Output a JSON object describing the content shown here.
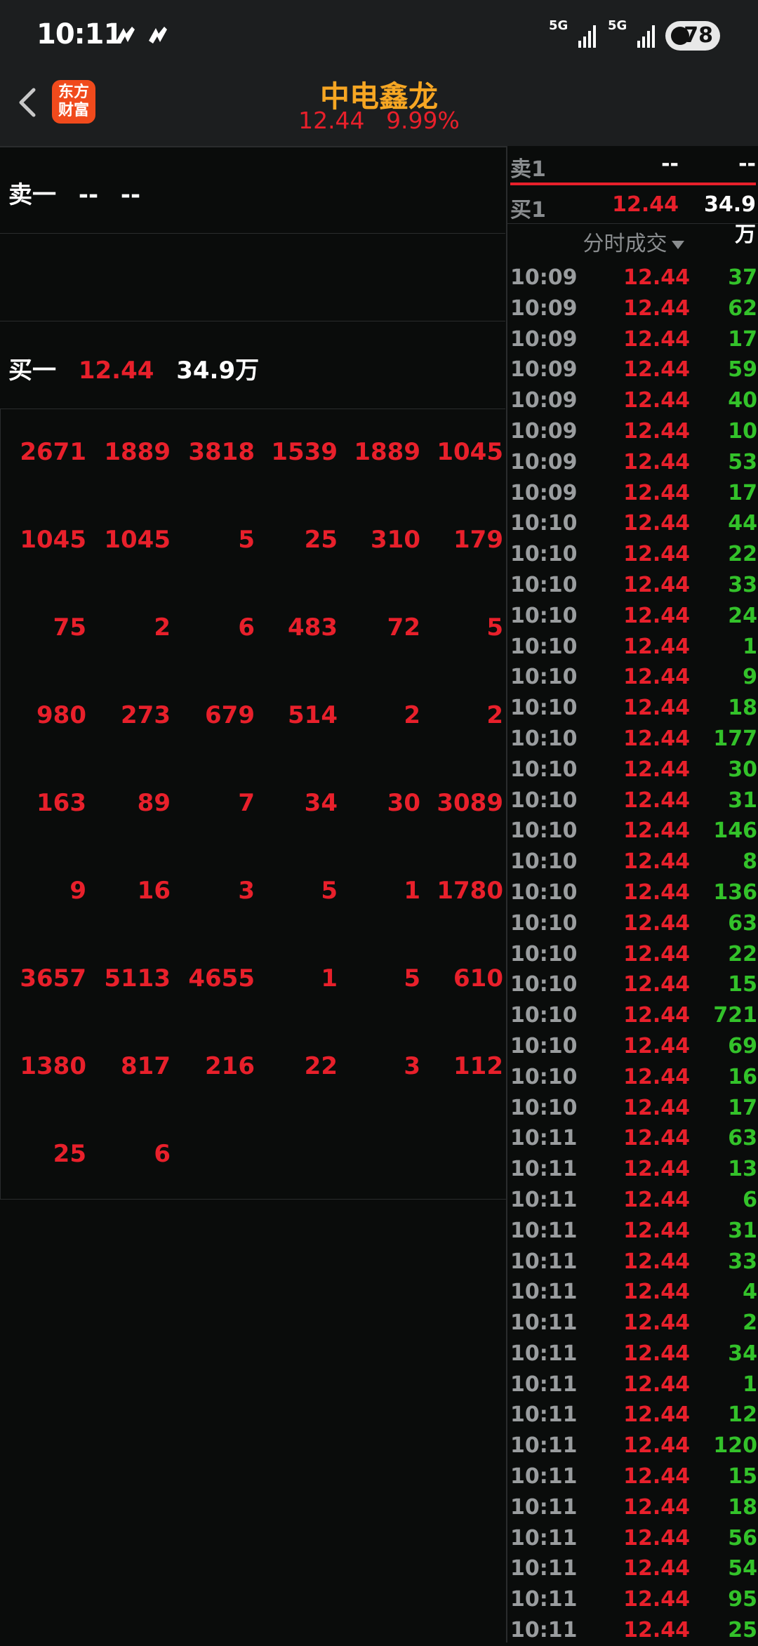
{
  "status_bar": {
    "time": "10:11",
    "network_1": "5G",
    "network_2": "5G",
    "battery": "78"
  },
  "header": {
    "logo_line1": "东方",
    "logo_line2": "财富",
    "stock_name": "中电鑫龙",
    "price": "12.44",
    "change_pct": "9.99%"
  },
  "order_book": {
    "sell1": {
      "label": "卖一",
      "price": "--",
      "volume": "--"
    },
    "buy1": {
      "label": "买一",
      "price": "12.44",
      "volume": "34.9万"
    }
  },
  "queue_rows": [
    [
      "2671",
      "1889",
      "3818",
      "1539",
      "1889",
      "1045"
    ],
    [
      "1045",
      "1045",
      "5",
      "25",
      "310",
      "179"
    ],
    [
      "75",
      "2",
      "6",
      "483",
      "72",
      "5"
    ],
    [
      "980",
      "273",
      "679",
      "514",
      "2",
      "2"
    ],
    [
      "163",
      "89",
      "7",
      "34",
      "30",
      "3089"
    ],
    [
      "9",
      "16",
      "3",
      "5",
      "1",
      "1780"
    ],
    [
      "3657",
      "5113",
      "4655",
      "1",
      "5",
      "610"
    ],
    [
      "1380",
      "817",
      "216",
      "22",
      "3",
      "112"
    ],
    [
      "25",
      "6"
    ]
  ],
  "quote": {
    "sell1": {
      "label": "卖1",
      "price": "--",
      "volume": "--"
    },
    "buy1": {
      "label": "买1",
      "price": "12.44",
      "volume": "34.9万"
    }
  },
  "ticks_header": "分时成交",
  "ticks": [
    {
      "time": "10:09",
      "price": "12.44",
      "vol": "37"
    },
    {
      "time": "10:09",
      "price": "12.44",
      "vol": "62"
    },
    {
      "time": "10:09",
      "price": "12.44",
      "vol": "17"
    },
    {
      "time": "10:09",
      "price": "12.44",
      "vol": "59"
    },
    {
      "time": "10:09",
      "price": "12.44",
      "vol": "40"
    },
    {
      "time": "10:09",
      "price": "12.44",
      "vol": "10"
    },
    {
      "time": "10:09",
      "price": "12.44",
      "vol": "53"
    },
    {
      "time": "10:09",
      "price": "12.44",
      "vol": "17"
    },
    {
      "time": "10:10",
      "price": "12.44",
      "vol": "44"
    },
    {
      "time": "10:10",
      "price": "12.44",
      "vol": "22"
    },
    {
      "time": "10:10",
      "price": "12.44",
      "vol": "33"
    },
    {
      "time": "10:10",
      "price": "12.44",
      "vol": "24"
    },
    {
      "time": "10:10",
      "price": "12.44",
      "vol": "1"
    },
    {
      "time": "10:10",
      "price": "12.44",
      "vol": "9"
    },
    {
      "time": "10:10",
      "price": "12.44",
      "vol": "18"
    },
    {
      "time": "10:10",
      "price": "12.44",
      "vol": "177"
    },
    {
      "time": "10:10",
      "price": "12.44",
      "vol": "30"
    },
    {
      "time": "10:10",
      "price": "12.44",
      "vol": "31"
    },
    {
      "time": "10:10",
      "price": "12.44",
      "vol": "146"
    },
    {
      "time": "10:10",
      "price": "12.44",
      "vol": "8"
    },
    {
      "time": "10:10",
      "price": "12.44",
      "vol": "136"
    },
    {
      "time": "10:10",
      "price": "12.44",
      "vol": "63"
    },
    {
      "time": "10:10",
      "price": "12.44",
      "vol": "22"
    },
    {
      "time": "10:10",
      "price": "12.44",
      "vol": "15"
    },
    {
      "time": "10:10",
      "price": "12.44",
      "vol": "721"
    },
    {
      "time": "10:10",
      "price": "12.44",
      "vol": "69"
    },
    {
      "time": "10:10",
      "price": "12.44",
      "vol": "16"
    },
    {
      "time": "10:10",
      "price": "12.44",
      "vol": "17"
    },
    {
      "time": "10:11",
      "price": "12.44",
      "vol": "63"
    },
    {
      "time": "10:11",
      "price": "12.44",
      "vol": "13"
    },
    {
      "time": "10:11",
      "price": "12.44",
      "vol": "6"
    },
    {
      "time": "10:11",
      "price": "12.44",
      "vol": "31"
    },
    {
      "time": "10:11",
      "price": "12.44",
      "vol": "33"
    },
    {
      "time": "10:11",
      "price": "12.44",
      "vol": "4"
    },
    {
      "time": "10:11",
      "price": "12.44",
      "vol": "2"
    },
    {
      "time": "10:11",
      "price": "12.44",
      "vol": "34"
    },
    {
      "time": "10:11",
      "price": "12.44",
      "vol": "1"
    },
    {
      "time": "10:11",
      "price": "12.44",
      "vol": "12"
    },
    {
      "time": "10:11",
      "price": "12.44",
      "vol": "120"
    },
    {
      "time": "10:11",
      "price": "12.44",
      "vol": "15"
    },
    {
      "time": "10:11",
      "price": "12.44",
      "vol": "18"
    },
    {
      "time": "10:11",
      "price": "12.44",
      "vol": "56"
    },
    {
      "time": "10:11",
      "price": "12.44",
      "vol": "54"
    },
    {
      "time": "10:11",
      "price": "12.44",
      "vol": "95"
    },
    {
      "time": "10:11",
      "price": "12.44",
      "vol": "25"
    }
  ],
  "colors": {
    "up": "#e8202b",
    "down": "#33c22a",
    "stock_name": "#f6a623",
    "background": "#0a0c0b"
  },
  "icons": [
    "back-arrow-icon",
    "notification-icon",
    "signal-icon",
    "battery-icon",
    "dropdown-triangle-icon"
  ]
}
